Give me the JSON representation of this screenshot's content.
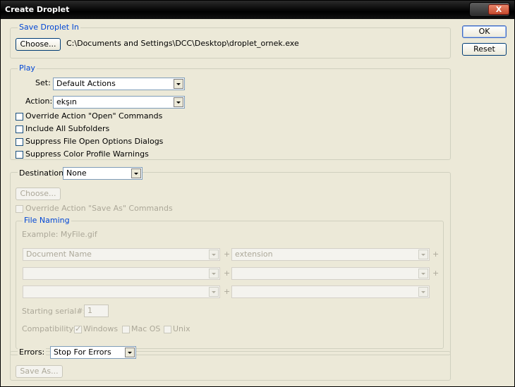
{
  "window": {
    "title": "Create Droplet",
    "close_glyph": "X"
  },
  "buttons": {
    "ok": "OK",
    "reset": "Reset"
  },
  "save_in": {
    "legend": "Save Droplet In",
    "choose": "Choose...",
    "path": "C:\\Documents and Settings\\DCC\\Desktop\\droplet_ornek.exe"
  },
  "play": {
    "legend": "Play",
    "set_label": "Set:",
    "set_value": "Default Actions",
    "action_label": "Action:",
    "action_value": "ekşın",
    "options": [
      {
        "label": "Override Action \"Open\" Commands",
        "checked": false
      },
      {
        "label": "Include All Subfolders",
        "checked": false
      },
      {
        "label": "Suppress File Open Options Dialogs",
        "checked": false
      },
      {
        "label": "Suppress Color Profile Warnings",
        "checked": false
      }
    ]
  },
  "destination": {
    "label": "Destination:",
    "value": "None",
    "choose": "Choose...",
    "override_label": "Override Action \"Save As\" Commands",
    "file_naming": {
      "legend": "File Naming",
      "example": "Example: MyFile.gif",
      "rows": [
        {
          "left": "Document Name",
          "right": "extension"
        },
        {
          "left": "",
          "right": ""
        },
        {
          "left": "",
          "right": ""
        }
      ],
      "plus": "+",
      "serial_label": "Starting serial#:",
      "serial_value": "1",
      "compat_label": "Compatibility:",
      "compat": [
        {
          "label": "Windows",
          "checked": true
        },
        {
          "label": "Mac OS",
          "checked": false
        },
        {
          "label": "Unix",
          "checked": false
        }
      ]
    }
  },
  "errors": {
    "label": "Errors:",
    "value": "Stop For Errors",
    "save_as": "Save As..."
  }
}
